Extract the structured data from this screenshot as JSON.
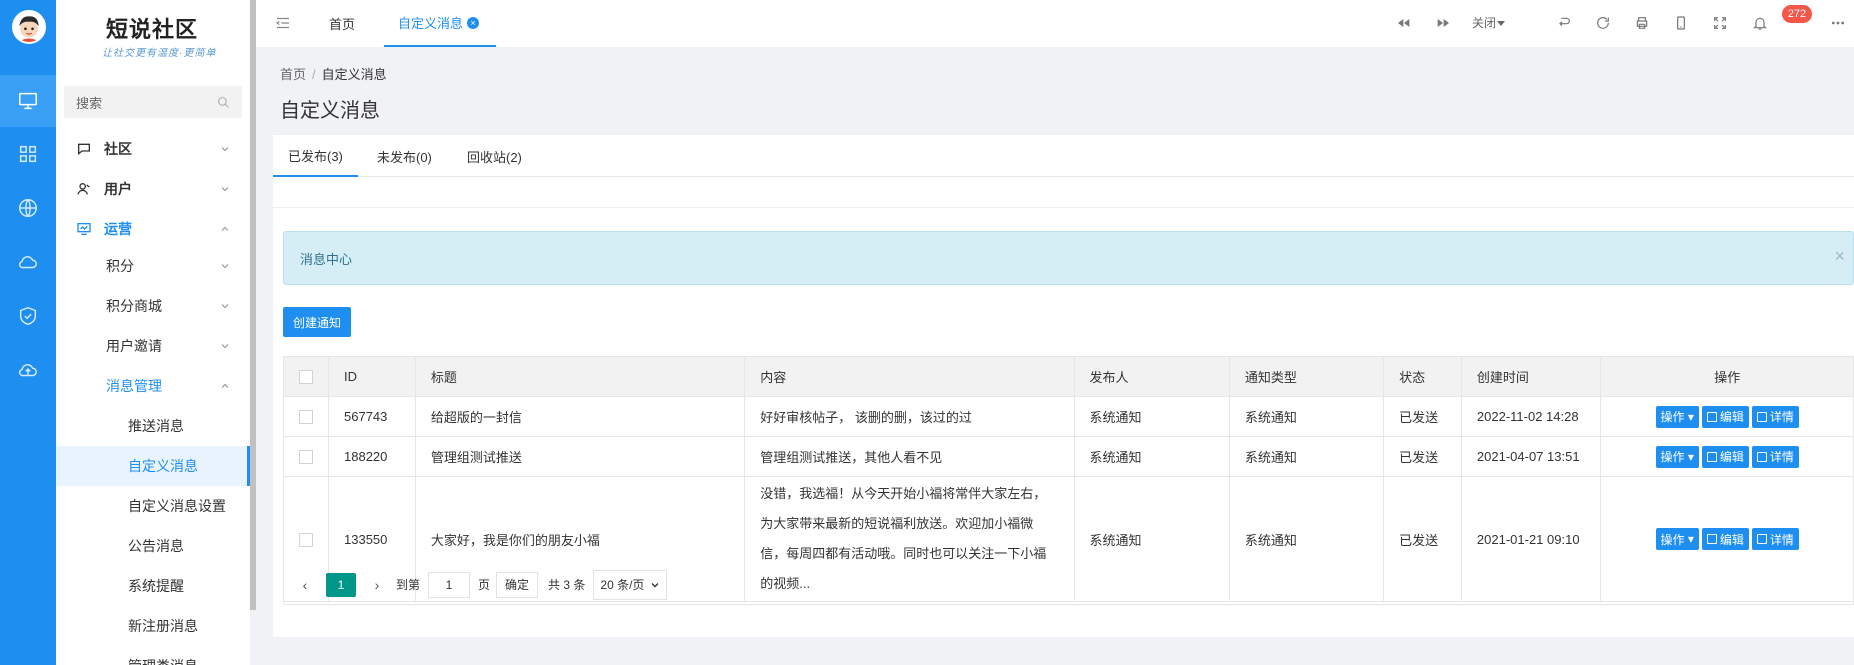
{
  "app": {
    "logo_title": "短说社区",
    "logo_subtitle": "让社交更有温度·更简单"
  },
  "rail": {
    "icons": [
      "monitor-icon",
      "grid-icon",
      "globe-icon",
      "cloud-icon",
      "shield-check-icon",
      "cloud-upload-icon"
    ],
    "active_index": 0
  },
  "sidebar": {
    "search_placeholder": "搜索",
    "items": [
      {
        "label": "社区",
        "icon": "chat-icon",
        "state": "collapsed"
      },
      {
        "label": "用户",
        "icon": "user-icon",
        "state": "collapsed"
      },
      {
        "label": "运营",
        "icon": "operate-icon",
        "state": "expanded"
      },
      {
        "label": "积分",
        "state": "collapsed"
      },
      {
        "label": "积分商城",
        "state": "collapsed"
      },
      {
        "label": "用户邀请",
        "state": "collapsed"
      },
      {
        "label": "消息管理",
        "state": "expanded"
      },
      {
        "label": "推送消息"
      },
      {
        "label": "自定义消息",
        "current": true
      },
      {
        "label": "自定义消息设置"
      },
      {
        "label": "公告消息"
      },
      {
        "label": "系统提醒"
      },
      {
        "label": "新注册消息"
      },
      {
        "label": "管理类消息"
      }
    ]
  },
  "topbar": {
    "tabs": [
      {
        "label": "首页"
      },
      {
        "label": "自定义消息",
        "active": true
      }
    ],
    "close_label": "关闭",
    "notification_count": "272",
    "accent": "#1e8ff0"
  },
  "breadcrumb": {
    "home": "首页",
    "current": "自定义消息"
  },
  "page_title": "自定义消息",
  "content_tabs": [
    {
      "label": "已发布(3)",
      "active": true
    },
    {
      "label": "未发布(0)"
    },
    {
      "label": "回收站(2)"
    }
  ],
  "alert": {
    "text": "消息中心",
    "close": "×"
  },
  "create_button": "创建通知",
  "table": {
    "columns": [
      "ID",
      "标题",
      "内容",
      "发布人",
      "通知类型",
      "状态",
      "创建时间",
      "操作"
    ],
    "rows": [
      {
        "id": "567743",
        "title": "给超版的一封信",
        "content": "好好审核帖子， 该删的删，该过的过",
        "publisher": "系统通知",
        "type": "系统通知",
        "status": "已发送",
        "created": "2022-11-02 14:28"
      },
      {
        "id": "188220",
        "title": "管理组测试推送",
        "content": "管理组测试推送，其他人看不见",
        "publisher": "系统通知",
        "type": "系统通知",
        "status": "已发送",
        "created": "2021-04-07 13:51"
      },
      {
        "id": "133550",
        "title": "大家好，我是你们的朋友小福",
        "content": "没错，我选福！从今天开始小福将常伴大家左右，为大家带来最新的短说福利放送。欢迎加小福微信，每周四都有活动哦。同时也可以关注一下小福的视频...",
        "publisher": "系统通知",
        "type": "系统通知",
        "status": "已发送",
        "created": "2021-01-21 09:10"
      }
    ],
    "actions": {
      "op": "操作",
      "edit": "编辑",
      "detail": "详情"
    }
  },
  "pager": {
    "current_page": "1",
    "goto_label": "到第",
    "goto_value": "1",
    "page_unit": "页",
    "confirm": "确定",
    "total": "共 3 条",
    "page_size": "20 条/页"
  }
}
